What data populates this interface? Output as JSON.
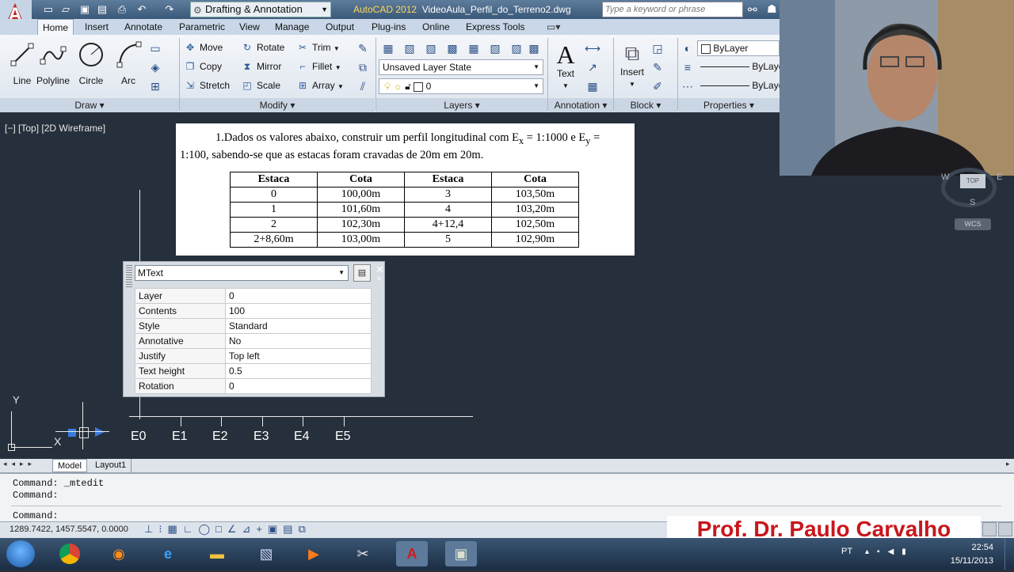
{
  "titlebar": {
    "workspace": "Drafting & Annotation",
    "app_title_app": "AutoCAD 2012",
    "app_title_file": "VideoAula_Perfil_do_Terreno2.dwg",
    "search_placeholder": "Type a keyword or phrase"
  },
  "tabs": [
    "Home",
    "Insert",
    "Annotate",
    "Parametric",
    "View",
    "Manage",
    "Output",
    "Plug-ins",
    "Online",
    "Express Tools"
  ],
  "ribbon": {
    "draw": {
      "title": "Draw",
      "tools": [
        "Line",
        "Polyline",
        "Circle",
        "Arc"
      ]
    },
    "modify": {
      "title": "Modify",
      "tools": [
        "Move",
        "Rotate",
        "Trim",
        "Copy",
        "Mirror",
        "Fillet",
        "Stretch",
        "Scale",
        "Array"
      ]
    },
    "layers": {
      "title": "Layers",
      "layer_state": "Unsaved Layer State",
      "current_layer": "0"
    },
    "annotation": {
      "title": "Annotation",
      "text_label": "Text"
    },
    "block": {
      "title": "Block",
      "insert_label": "Insert"
    },
    "properties": {
      "title": "Properties",
      "color": "ByLayer",
      "linetype": "ByLaye",
      "lineweight": "ByLaye"
    }
  },
  "viewport": {
    "label": "[−] [Top] [2D Wireframe]"
  },
  "document": {
    "number": "1.",
    "text_start": "Dados os valores abaixo, construir um perfil longitudinal com E",
    "sub_x": "x",
    "text_mid": " = 1:1000 e E",
    "sub_y": "y",
    "text_end": " = 1:100, sabendo-se que as estacas foram cravadas de 20m em 20m.",
    "headers": [
      "Estaca",
      "Cota",
      "Estaca",
      "Cota"
    ],
    "rows": [
      [
        "0",
        "100,00m",
        "3",
        "103,50m"
      ],
      [
        "1",
        "101,60m",
        "4",
        "103,20m"
      ],
      [
        "2",
        "102,30m",
        "4+12,4",
        "102,50m"
      ],
      [
        "2+8,60m",
        "103,00m",
        "5",
        "102,90m"
      ]
    ]
  },
  "quick_properties": {
    "object_type": "MText",
    "rows": [
      {
        "key": "Layer",
        "value": "0"
      },
      {
        "key": "Contents",
        "value": "100"
      },
      {
        "key": "Style",
        "value": "Standard"
      },
      {
        "key": "Annotative",
        "value": "No"
      },
      {
        "key": "Justify",
        "value": "Top left"
      },
      {
        "key": "Text height",
        "value": "0.5"
      },
      {
        "key": "Rotation",
        "value": "0"
      }
    ]
  },
  "stations": [
    "E0",
    "E1",
    "E2",
    "E3",
    "E4",
    "E5"
  ],
  "ucs": {
    "y_label": "Y",
    "x_label": "X"
  },
  "viewcube": {
    "w": "W",
    "e": "E",
    "s": "S",
    "top": "TOP",
    "wcs": "WCS"
  },
  "layout_tabs": [
    "Model",
    "Layout1"
  ],
  "command_lines": [
    "Command:  _mtedit",
    "Command:",
    "Command:"
  ],
  "status": {
    "coords": "1289.7422, 1457.5547, 0.0000"
  },
  "banner": "Prof. Dr. Paulo Carvalho",
  "taskbar": {
    "lang": "PT",
    "time": "22:54",
    "date": "15/11/2013"
  },
  "colors": {
    "accent": "#c8161d",
    "drawing_bg": "#26303c",
    "ribbon_bg": "#e8edf3"
  }
}
